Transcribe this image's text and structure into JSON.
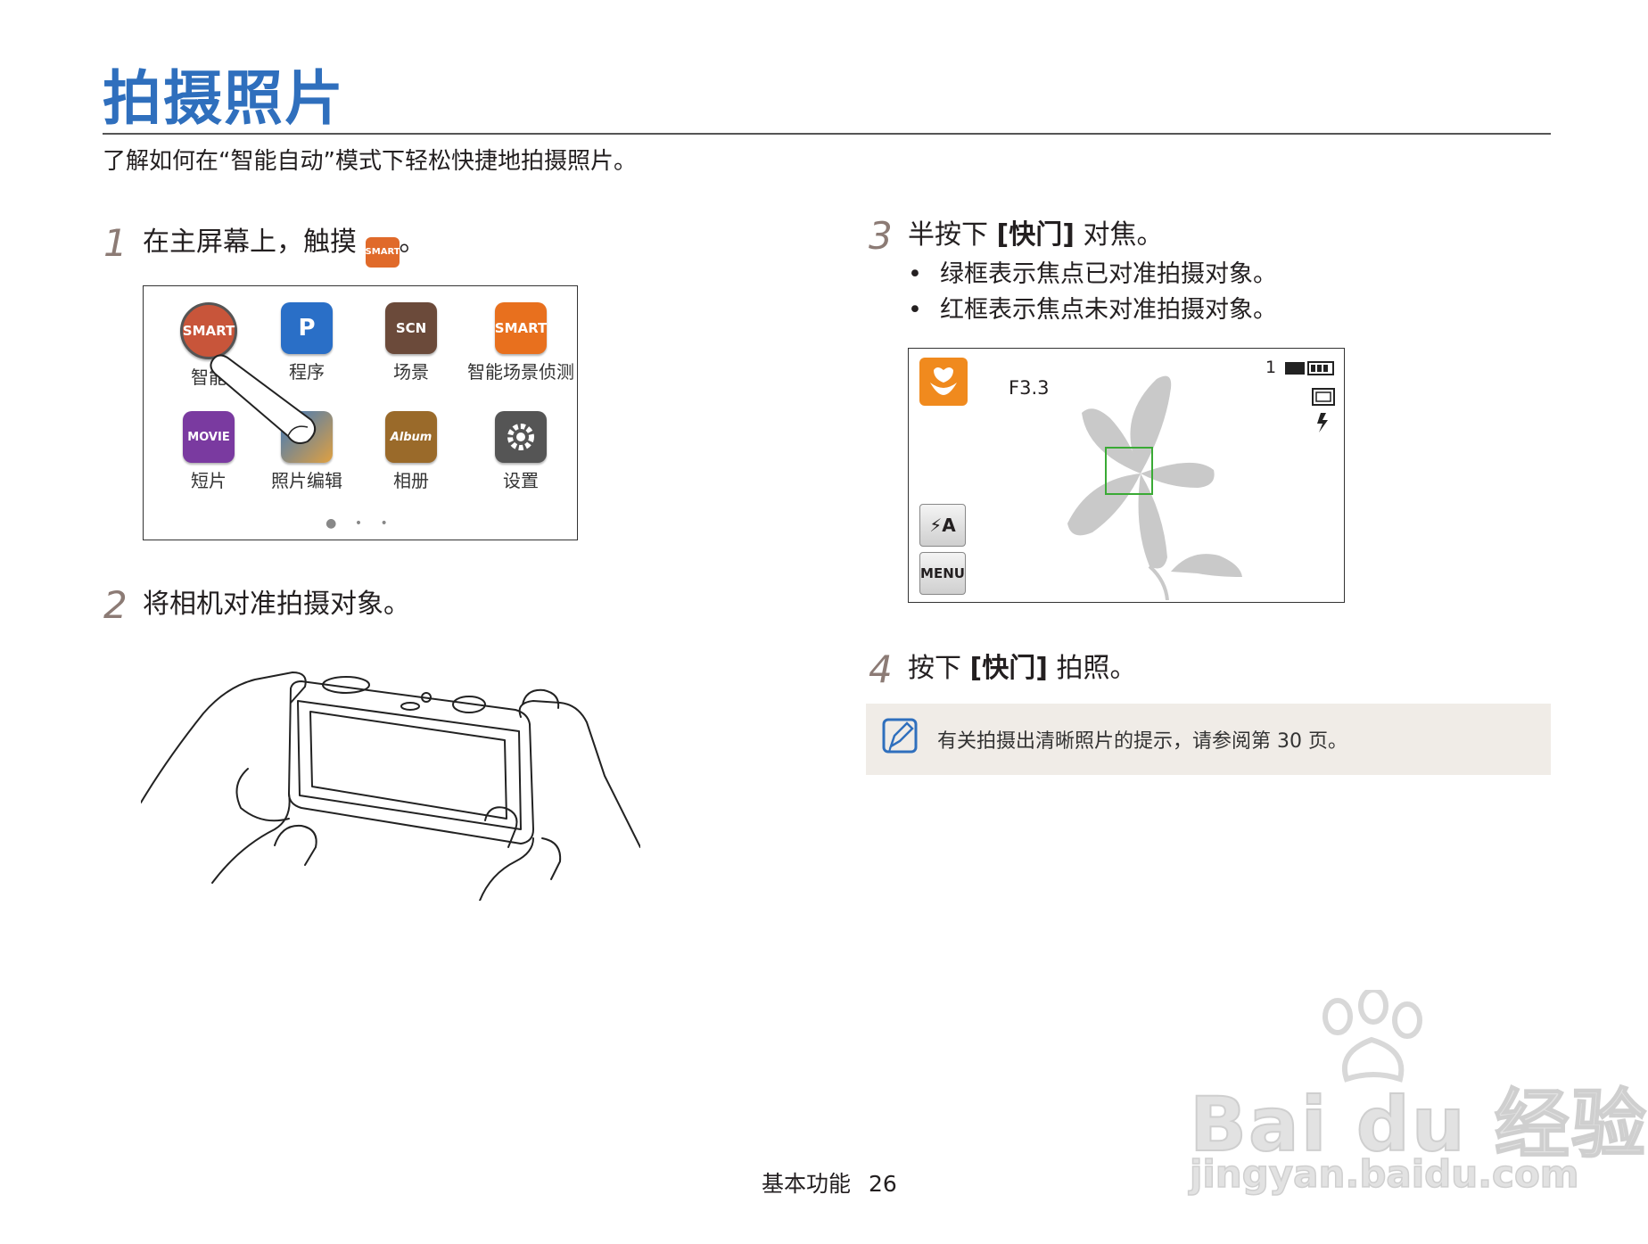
{
  "page": {
    "title": "拍摄照片",
    "subtitle": "了解如何在“智能自动”模式下轻松快捷地拍摄照片。"
  },
  "steps": [
    {
      "num": "1",
      "text": "在主屏幕上，触摸",
      "suffix": "。",
      "icon_label": "SMART"
    },
    {
      "num": "2",
      "text": "将相机对准拍摄对象。"
    },
    {
      "num": "3",
      "text_pre": "半按下 ",
      "key": "[快门]",
      "text_post": " 对焦。",
      "bullets": [
        "绿框表示焦点已对准拍摄对象。",
        "红框表示焦点未对准拍摄对象。"
      ]
    },
    {
      "num": "4",
      "text_pre": "按下 ",
      "key": "[快门]",
      "text_post": " 拍照。"
    }
  ],
  "home_screen": {
    "apps": [
      {
        "label": "智能",
        "icon_text": "SMART",
        "color": "#c8553a",
        "icon": "smart-auto-icon"
      },
      {
        "label": "程序",
        "icon_text": "P",
        "color": "#2a6fc7",
        "icon": "program-icon"
      },
      {
        "label": "场景",
        "icon_text": "SCN",
        "color": "#6b4a3a",
        "icon": "scene-icon"
      },
      {
        "label": "智能场景侦测",
        "icon_text": "SMART",
        "color": "#e8701e",
        "icon": "smart-scene-icon"
      },
      {
        "label": "短片",
        "icon_text": "MOVIE",
        "color": "#7a3aa0",
        "icon": "movie-icon"
      },
      {
        "label": "照片编辑",
        "icon_text": "",
        "color": "#3a78c0",
        "icon": "photo-edit-icon"
      },
      {
        "label": "相册",
        "icon_text": "Album",
        "color": "#9a6a2a",
        "icon": "album-icon"
      },
      {
        "label": "设置",
        "icon_text": "",
        "color": "#555555",
        "icon": "settings-icon"
      }
    ],
    "pager": "● • •"
  },
  "camera_screen": {
    "aperture": "F3.3",
    "shots_remaining": "1",
    "menu_label": "MENU",
    "flash_label": "⚡A",
    "focus_frame_color": "#3aaa35"
  },
  "note": {
    "text": "有关拍摄出清晰照片的提示，请参阅第 30 页。"
  },
  "footer": {
    "section": "基本功能",
    "page": "26"
  },
  "watermark": {
    "brand": "Bai du 经验",
    "url": "jingyan.baidu.com"
  }
}
